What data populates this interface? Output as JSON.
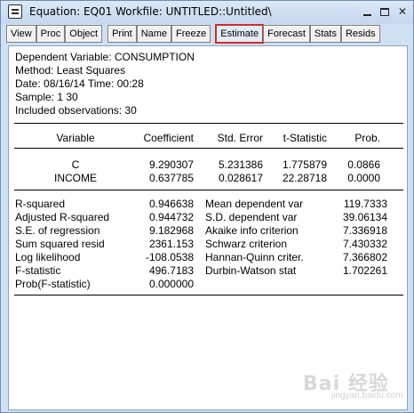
{
  "window": {
    "title": "Equation: EQ01   Workfile: UNTITLED::Untitled\\",
    "min_icon": "minimize-icon",
    "max_icon": "maximize-icon",
    "close_glyph": "✕"
  },
  "toolbar": {
    "items": [
      "View",
      "Proc",
      "Object",
      "Print",
      "Name",
      "Freeze",
      "Estimate",
      "Forecast",
      "Stats",
      "Resids"
    ],
    "active": "Estimate",
    "active_outline_color": "#d42828"
  },
  "header": {
    "dependent": "Dependent Variable: CONSUMPTION",
    "method": "Method: Least Squares",
    "date": "Date: 08/16/14   Time: 00:28",
    "sample": "Sample: 1 30",
    "obs": "Included observations: 30"
  },
  "coef_table": {
    "columns": [
      "Variable",
      "Coefficient",
      "Std. Error",
      "t-Statistic",
      "Prob."
    ],
    "rows": [
      [
        "C",
        "9.290307",
        "5.231386",
        "1.775879",
        "0.0866"
      ],
      [
        "INCOME",
        "0.637785",
        "0.028617",
        "22.28718",
        "0.0000"
      ]
    ]
  },
  "stats_table": {
    "left": [
      [
        "R-squared",
        "0.946638"
      ],
      [
        "Adjusted R-squared",
        "0.944732"
      ],
      [
        "S.E. of regression",
        "9.182968"
      ],
      [
        "Sum squared resid",
        "2361.153"
      ],
      [
        "Log likelihood",
        "-108.0538"
      ],
      [
        "F-statistic",
        "496.7183"
      ],
      [
        "Prob(F-statistic)",
        "0.000000"
      ]
    ],
    "right": [
      [
        "Mean dependent var",
        "119.7333"
      ],
      [
        "S.D. dependent var",
        "39.06134"
      ],
      [
        "Akaike info criterion",
        "7.336918"
      ],
      [
        "Schwarz criterion",
        "7.430332"
      ],
      [
        "Hannan-Quinn criter.",
        "7.366802"
      ],
      [
        "Durbin-Watson stat",
        "1.702261"
      ]
    ]
  },
  "watermark": {
    "main": "Bai 经验",
    "sub": "jingyan.baidu.com"
  }
}
